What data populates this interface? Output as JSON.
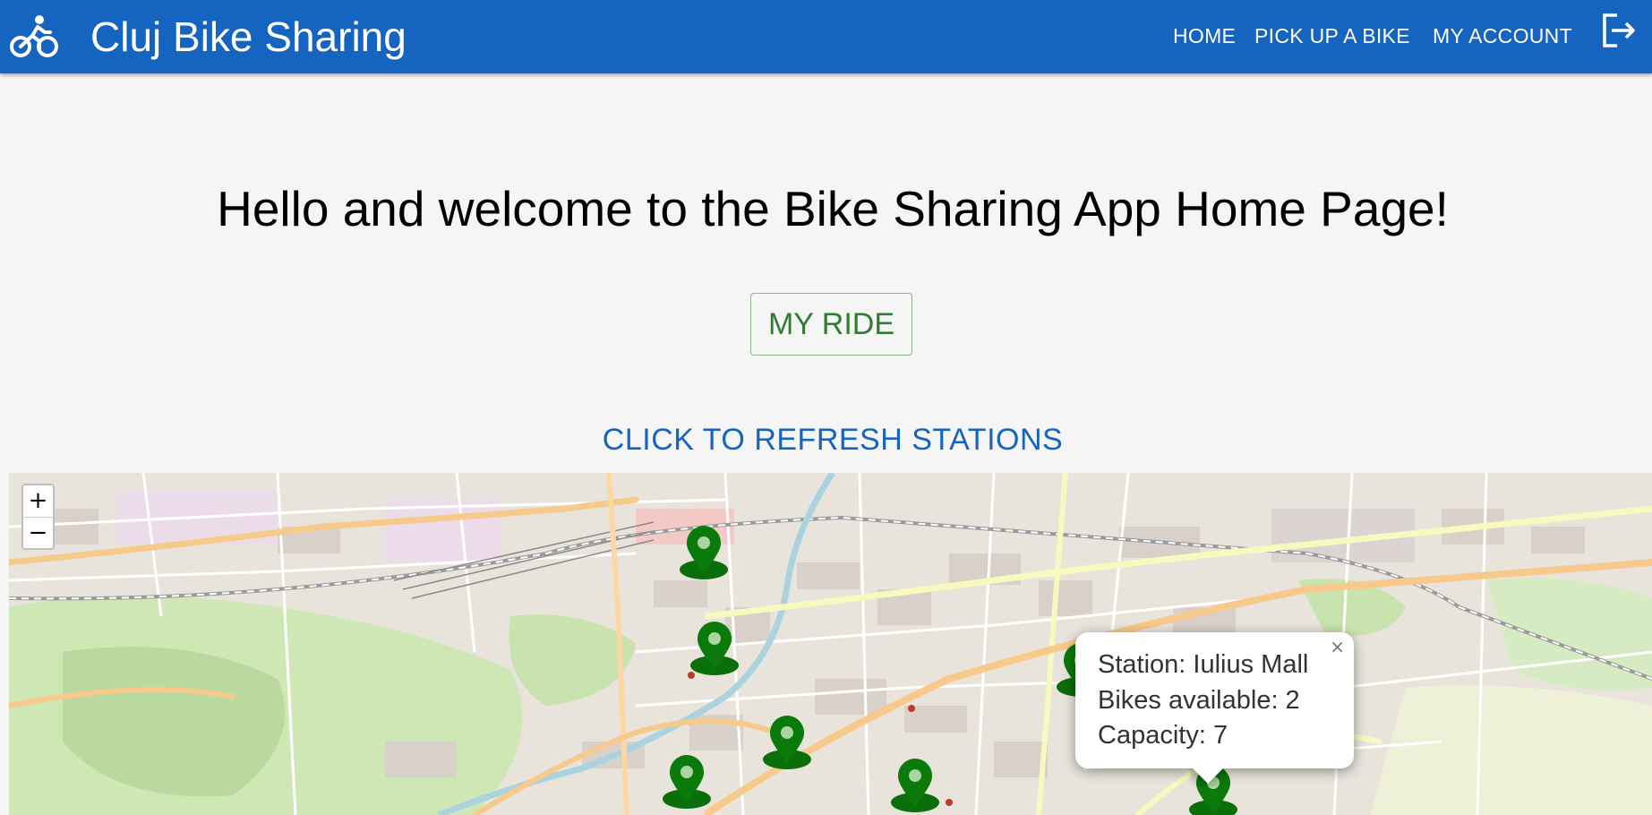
{
  "appbar": {
    "title": "Cluj Bike Sharing",
    "logo_icon": "bike-icon",
    "nav": [
      "HOME",
      "PICK UP A BIKE",
      "MY ACCOUNT"
    ],
    "logout_icon": "logout-icon",
    "bg_color": "#1565c0"
  },
  "main": {
    "welcome": "Hello and welcome to the Bike Sharing App Home Page!",
    "my_ride_label": "MY RIDE",
    "refresh_label": "CLICK TO REFRESH STATIONS"
  },
  "map": {
    "zoom_in": "+",
    "zoom_out": "−",
    "marker_color": "#0a7a0a",
    "popup": {
      "station": "Station: Iulius Mall",
      "bikes": "Bikes available: 2",
      "capacity": "Capacity: 7",
      "close": "×"
    }
  }
}
